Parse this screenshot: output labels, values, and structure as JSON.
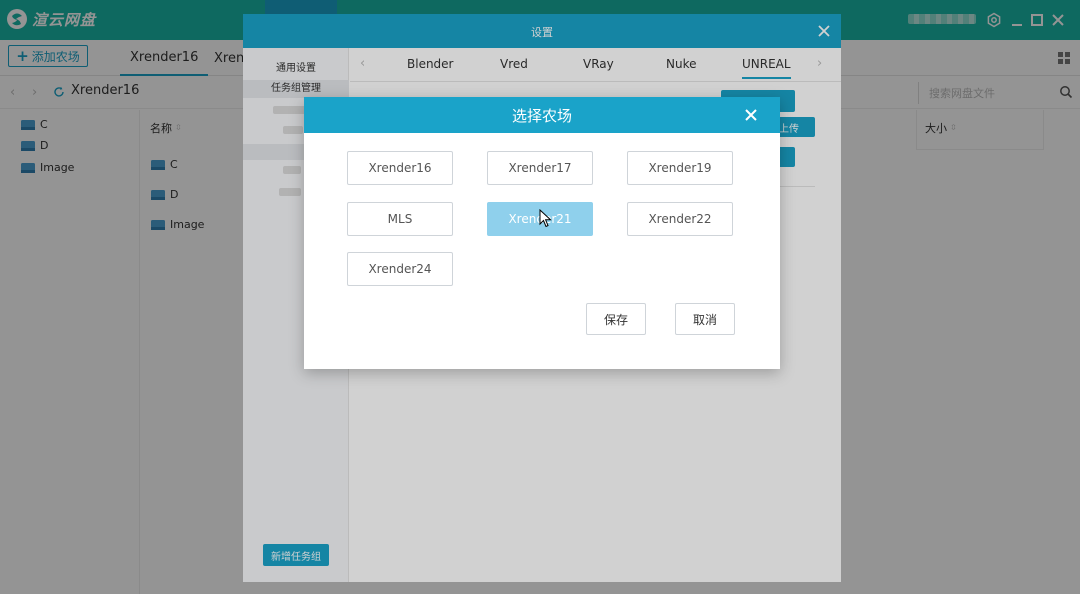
{
  "app": {
    "title": "渲云网盘",
    "colors": {
      "titlebar": "#19b5a5",
      "accent": "#1aa3c9",
      "selected": "#8fd0ec"
    }
  },
  "toolbar": {
    "add_farm_label": "添加农场",
    "tabs": [
      {
        "label": "Xrender16",
        "active": true
      },
      {
        "label": "Xren",
        "active": false
      }
    ]
  },
  "breadcrumb": {
    "path": "Xrender16"
  },
  "search": {
    "placeholder": "搜索网盘文件"
  },
  "tree": {
    "items": [
      {
        "label": "C"
      },
      {
        "label": "D"
      },
      {
        "label": "Image"
      }
    ]
  },
  "filelist": {
    "col_name": "名称",
    "col_size": "大小",
    "rows": [
      {
        "name": "C"
      },
      {
        "name": "D"
      },
      {
        "name": "Image"
      }
    ]
  },
  "settings": {
    "title": "设置",
    "side_items": [
      {
        "label": "通用设置"
      },
      {
        "label": "任务组管理"
      }
    ],
    "new_group_label": "新增任务组",
    "tabs": [
      {
        "label": "Blender"
      },
      {
        "label": "Vred"
      },
      {
        "label": "VRay"
      },
      {
        "label": "Nuke"
      },
      {
        "label": "UNREAL"
      }
    ],
    "upload_label": "上传"
  },
  "farm_modal": {
    "title": "选择农场",
    "options": [
      {
        "label": "Xrender16",
        "selected": false
      },
      {
        "label": "Xrender17",
        "selected": false
      },
      {
        "label": "Xrender19",
        "selected": false
      },
      {
        "label": "MLS",
        "selected": false
      },
      {
        "label": "Xrender21",
        "selected": true
      },
      {
        "label": "Xrender22",
        "selected": false
      },
      {
        "label": "Xrender24",
        "selected": false
      }
    ],
    "save_label": "保存",
    "cancel_label": "取消"
  }
}
